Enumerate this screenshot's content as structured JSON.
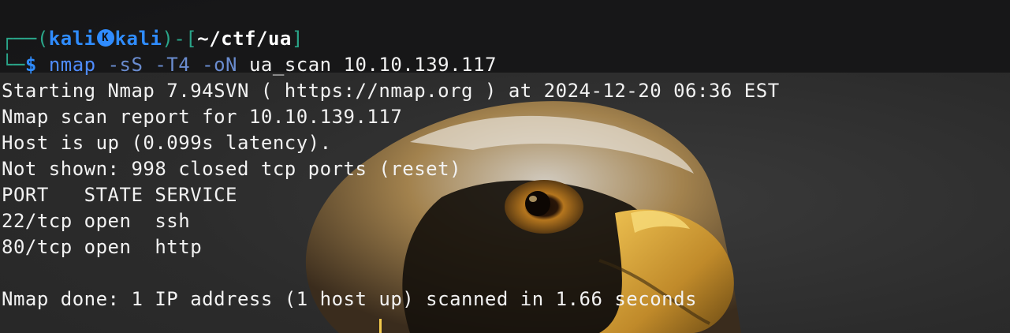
{
  "prompt": {
    "frame_open": "┌──(",
    "user": "kali",
    "logo_glyph": "K",
    "host": "kali",
    "frame_mid": ")-[",
    "cwd": "~/ctf/ua",
    "frame_close": "]",
    "frame_second": "└─",
    "symbol": "$",
    "command": "nmap",
    "flags": "-sS -T4 -oN",
    "args": "ua_scan 10.10.139.117"
  },
  "output": [
    "Starting Nmap 7.94SVN ( https://nmap.org ) at 2024-12-20 06:36 EST",
    "Nmap scan report for 10.10.139.117",
    "Host is up (0.099s latency).",
    "Not shown: 998 closed tcp ports (reset)",
    "PORT   STATE SERVICE",
    "22/tcp open  ssh",
    "80/tcp open  http",
    "",
    "Nmap done: 1 IP address (1 host up) scanned in 1.66 seconds"
  ],
  "colors": {
    "prompt_blue": "#2f8cff",
    "frame_teal": "#2aa68a",
    "text": "#f2f2f2",
    "cursor": "#f2c94c"
  },
  "icons": [
    "kali-dragon-icon",
    "eagle-wallpaper"
  ]
}
